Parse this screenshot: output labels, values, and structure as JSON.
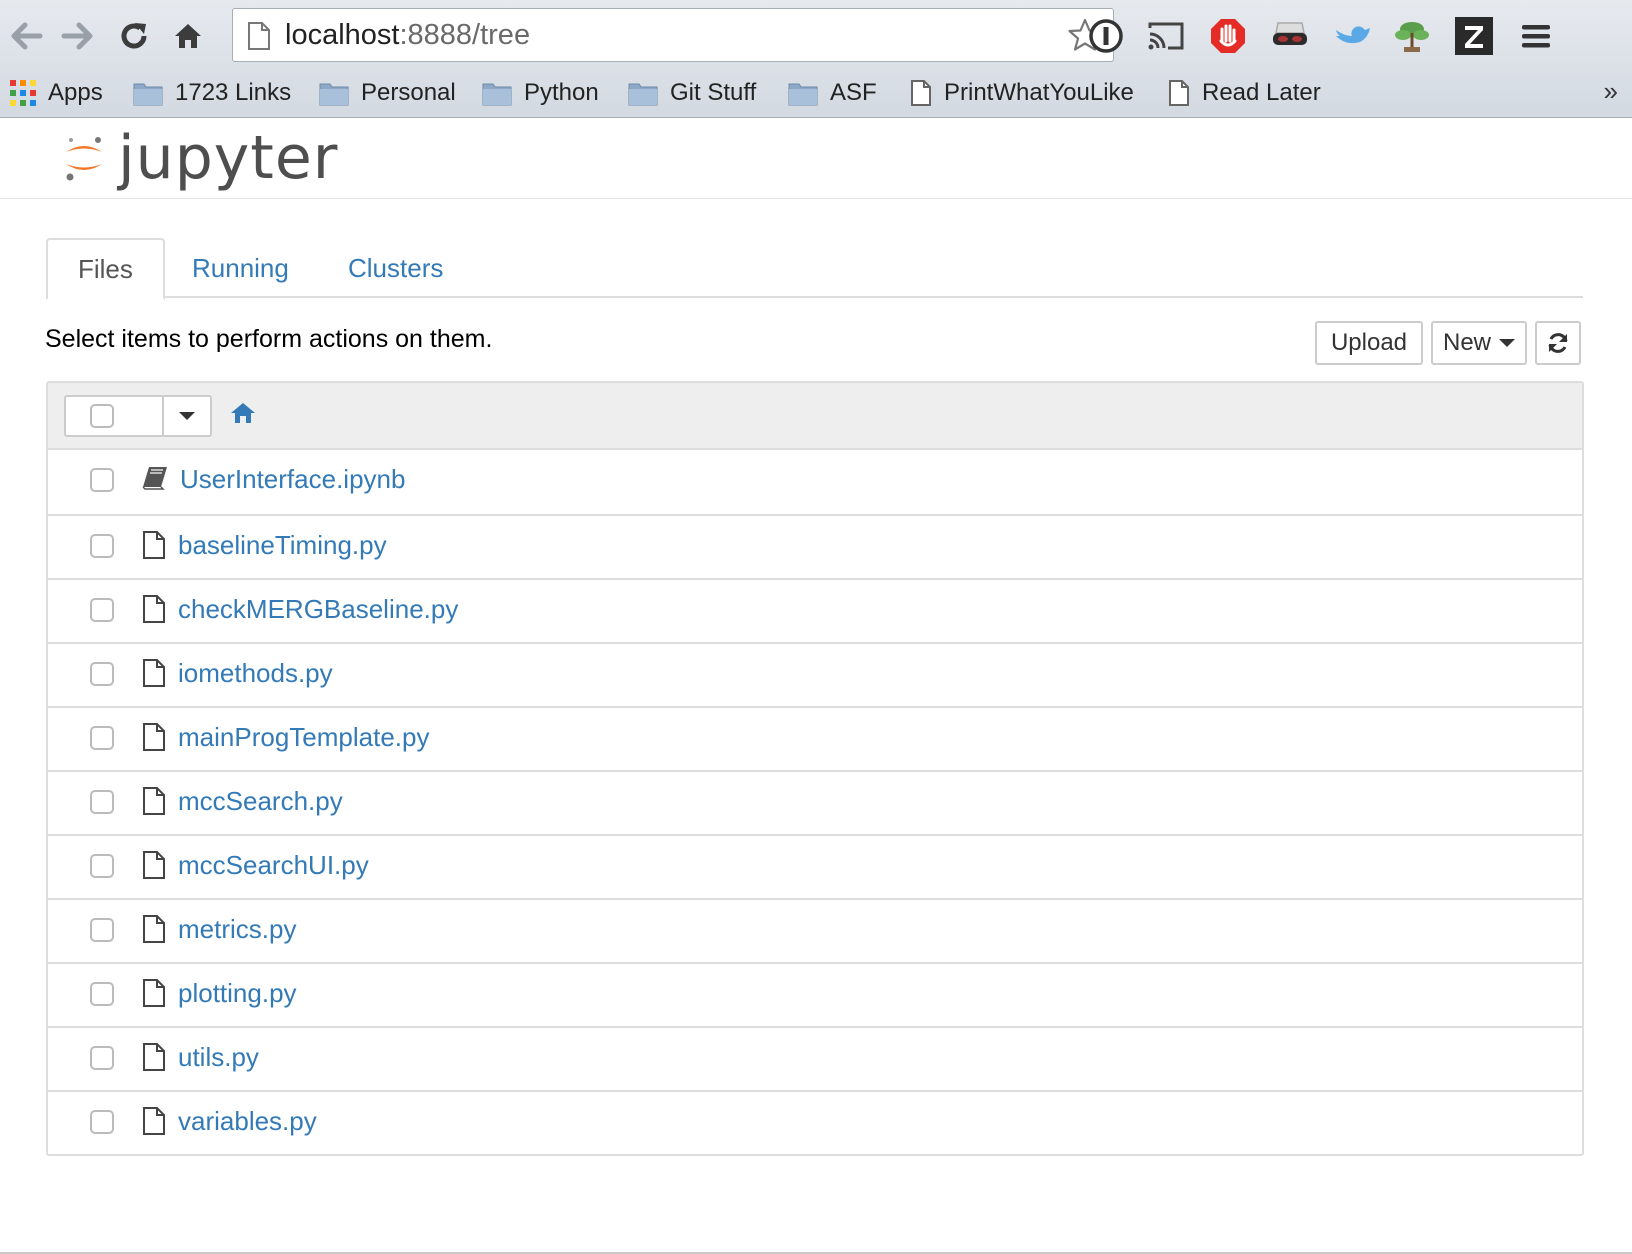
{
  "browser": {
    "url_host": "localhost",
    "url_rest": ":8888/tree",
    "bookmarks": [
      {
        "label": "Apps",
        "icon": "apps-grid-icon"
      },
      {
        "label": "1723 Links",
        "icon": "folder-icon"
      },
      {
        "label": "Personal",
        "icon": "folder-icon"
      },
      {
        "label": "Python",
        "icon": "folder-icon"
      },
      {
        "label": "Git Stuff",
        "icon": "folder-icon"
      },
      {
        "label": "ASF",
        "icon": "folder-icon"
      },
      {
        "label": "PrintWhatYouLike",
        "icon": "page-icon"
      },
      {
        "label": "Read Later",
        "icon": "page-icon"
      }
    ],
    "more_label": "»",
    "extensions": [
      "info-icon",
      "cast-icon",
      "adblock-icon",
      "incognito-mask-icon",
      "bird-icon",
      "bonsai-icon",
      "zotero-z-icon",
      "menu-icon"
    ]
  },
  "jupyter": {
    "logo_text": "jupyter",
    "tabs": [
      {
        "label": "Files",
        "active": true
      },
      {
        "label": "Running",
        "active": false
      },
      {
        "label": "Clusters",
        "active": false
      }
    ],
    "instructions": "Select items to perform actions on them.",
    "toolbar": {
      "upload_label": "Upload",
      "new_label": "New"
    },
    "files": [
      {
        "name": "UserInterface.ipynb",
        "type": "notebook"
      },
      {
        "name": "baselineTiming.py",
        "type": "file"
      },
      {
        "name": "checkMERGBaseline.py",
        "type": "file"
      },
      {
        "name": "iomethods.py",
        "type": "file"
      },
      {
        "name": "mainProgTemplate.py",
        "type": "file"
      },
      {
        "name": "mccSearch.py",
        "type": "file"
      },
      {
        "name": "mccSearchUI.py",
        "type": "file"
      },
      {
        "name": "metrics.py",
        "type": "file"
      },
      {
        "name": "plotting.py",
        "type": "file"
      },
      {
        "name": "utils.py",
        "type": "file"
      },
      {
        "name": "variables.py",
        "type": "file"
      }
    ]
  },
  "colors": {
    "link": "#337ab7",
    "jupyter_orange": "#f37726"
  }
}
